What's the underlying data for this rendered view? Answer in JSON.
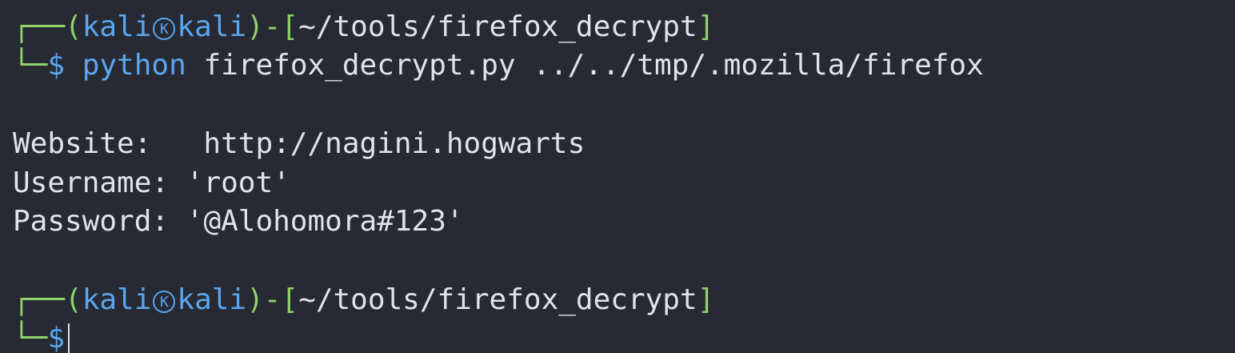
{
  "session1": {
    "box_top": "┌──(",
    "user": "kali",
    "at_symbol": "㉿",
    "host": "kali",
    "sep": ")-[",
    "path": "~/tools/firefox_decrypt",
    "close": "]",
    "box_bottom": "└─",
    "dollar": "$",
    "cmd_name": "python",
    "cmd_args": " firefox_decrypt.py ../../tmp/.mozilla/firefox"
  },
  "output": {
    "website_label": "Website:",
    "website_value": "http://nagini.hogwarts",
    "username_label": "Username:",
    "username_value": "'root'",
    "password_label": "Password:",
    "password_value": "'@Alohomora#123'"
  },
  "session2": {
    "box_top": "┌──(",
    "user": "kali",
    "at_symbol": "㉿",
    "host": "kali",
    "sep": ")-[",
    "path": "~/tools/firefox_decrypt",
    "close": "]",
    "box_bottom": "└─",
    "dollar": "$"
  }
}
